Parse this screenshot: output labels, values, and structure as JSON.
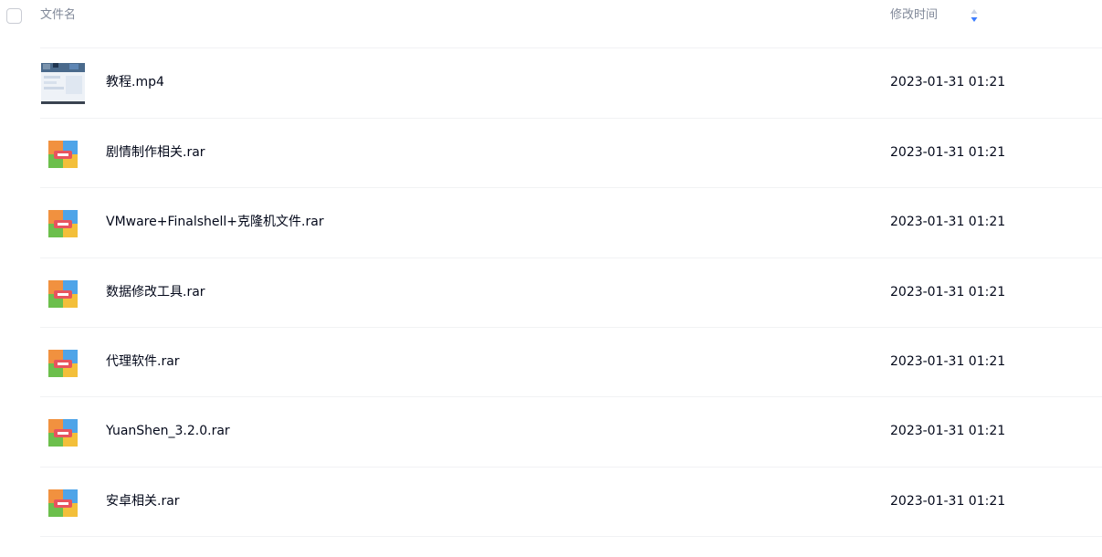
{
  "header": {
    "name_label": "文件名",
    "mtime_label": "修改时间"
  },
  "files": [
    {
      "name": "教程.mp4",
      "modified": "2023-01-31 01:21",
      "type": "video-thumbnail"
    },
    {
      "name": "剧情制作相关.rar",
      "modified": "2023-01-31 01:21",
      "type": "archive-icon"
    },
    {
      "name": "VMware+Finalshell+克隆机文件.rar",
      "modified": "2023-01-31 01:21",
      "type": "archive-icon"
    },
    {
      "name": "数据修改工具.rar",
      "modified": "2023-01-31 01:21",
      "type": "archive-icon"
    },
    {
      "name": "代理软件.rar",
      "modified": "2023-01-31 01:21",
      "type": "archive-icon"
    },
    {
      "name": "YuanShen_3.2.0.rar",
      "modified": "2023-01-31 01:21",
      "type": "archive-icon"
    },
    {
      "name": "安卓相关.rar",
      "modified": "2023-01-31 01:21",
      "type": "archive-icon"
    }
  ],
  "colors": {
    "accent": "#3b7cff",
    "header_text": "#818999",
    "text": "#03081a",
    "divider": "#f1f2f4"
  }
}
